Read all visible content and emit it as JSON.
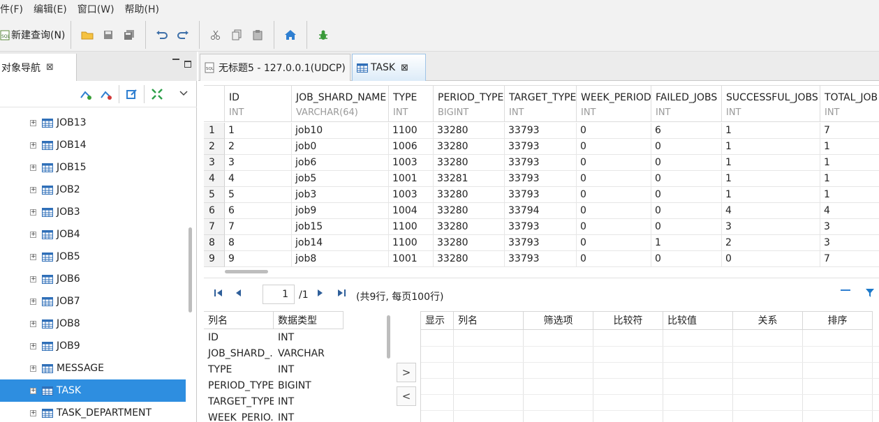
{
  "menu": [
    "件(F)",
    "编辑(E)",
    "窗口(W)",
    "帮助(H)"
  ],
  "toolbar": {
    "new_query": "新建查询(N)",
    "icons": [
      "new-query-icon",
      "open-folder-icon",
      "save-icon",
      "save-all-icon",
      "undo-icon",
      "redo-icon",
      "cut-icon",
      "copy-icon",
      "paste-icon",
      "home-icon",
      "debug-icon"
    ]
  },
  "navigator": {
    "title": "对象导航",
    "close": "⊠",
    "minimize": "▭",
    "maximize": "□",
    "items": [
      "JOB13",
      "JOB14",
      "JOB15",
      "JOB2",
      "JOB3",
      "JOB4",
      "JOB5",
      "JOB6",
      "JOB7",
      "JOB8",
      "JOB9",
      "MESSAGE",
      "TASK",
      "TASK_DEPARTMENT"
    ],
    "selected": "TASK"
  },
  "tabs": [
    {
      "label": "无标题5 - 127.0.0.1(UDCP)",
      "active": false
    },
    {
      "label": "TASK",
      "active": true
    }
  ],
  "grid": {
    "columns": [
      {
        "name": "ID",
        "type": "INT"
      },
      {
        "name": "JOB_SHARD_NAME",
        "type": "VARCHAR(64)"
      },
      {
        "name": "TYPE",
        "type": "INT"
      },
      {
        "name": "PERIOD_TYPE",
        "type": "BIGINT"
      },
      {
        "name": "TARGET_TYPE",
        "type": "INT"
      },
      {
        "name": "WEEK_PERIOD",
        "type": "INT"
      },
      {
        "name": "FAILED_JOBS",
        "type": "INT"
      },
      {
        "name": "SUCCESSFUL_JOBS",
        "type": "INT"
      },
      {
        "name": "TOTAL_JOB",
        "type": "INT"
      }
    ],
    "rows": [
      [
        "1",
        "1",
        "job10",
        "1100",
        "33280",
        "33793",
        "0",
        "6",
        "1",
        "7"
      ],
      [
        "2",
        "2",
        "job0",
        "1006",
        "33280",
        "33793",
        "0",
        "0",
        "1",
        "1"
      ],
      [
        "3",
        "3",
        "job6",
        "1003",
        "33280",
        "33793",
        "0",
        "0",
        "1",
        "1"
      ],
      [
        "4",
        "4",
        "job5",
        "1001",
        "33281",
        "33793",
        "0",
        "0",
        "1",
        "1"
      ],
      [
        "5",
        "5",
        "job3",
        "1003",
        "33280",
        "33793",
        "0",
        "0",
        "1",
        "1"
      ],
      [
        "6",
        "6",
        "job9",
        "1004",
        "33280",
        "33794",
        "0",
        "0",
        "4",
        "4"
      ],
      [
        "7",
        "7",
        "job15",
        "1100",
        "33280",
        "33793",
        "0",
        "0",
        "3",
        "3"
      ],
      [
        "8",
        "8",
        "job14",
        "1100",
        "33280",
        "33793",
        "0",
        "1",
        "2",
        "3"
      ],
      [
        "9",
        "9",
        "job8",
        "1001",
        "33280",
        "33793",
        "0",
        "0",
        "0",
        "7"
      ]
    ]
  },
  "pager": {
    "page": "1",
    "total": "/1",
    "summary": "(共9行, 每页100行)"
  },
  "column_pane": {
    "headers": [
      "列名",
      "数据类型"
    ],
    "rows": [
      [
        "ID",
        "INT"
      ],
      [
        "JOB_SHARD_...",
        "VARCHAR"
      ],
      [
        "TYPE",
        "INT"
      ],
      [
        "PERIOD_TYPE",
        "BIGINT"
      ],
      [
        "TARGET_TYPE",
        "INT"
      ],
      [
        "WEEK_PERIO...",
        "INT"
      ]
    ]
  },
  "move_buttons": {
    "right": ">",
    "left": "<"
  },
  "filter_pane": {
    "headers": [
      "显示",
      "列名",
      "筛选项",
      "比较符",
      "比较值",
      "关系",
      "排序"
    ]
  },
  "colors": {
    "selection": "#2e8ee0",
    "accent": "#1c79c9"
  }
}
